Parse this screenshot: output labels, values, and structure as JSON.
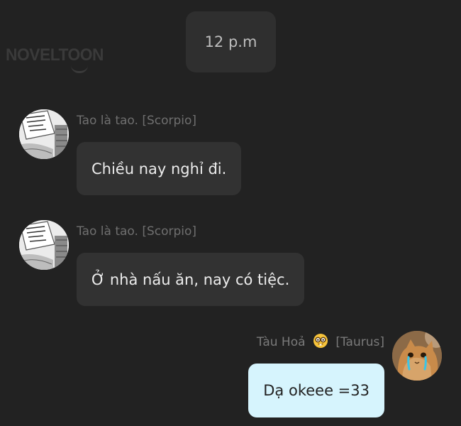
{
  "watermark": {
    "text": "NOVELTOON"
  },
  "timestamp": "12 p.m",
  "messages": [
    {
      "sender": "Tao là tao. [Scorpio]",
      "text": "Chiều nay nghỉ đi.",
      "avatar": "manga-panel-avatar"
    },
    {
      "sender": "Tao là tao. [Scorpio]",
      "text": "Ở nhà nấu ăn, nay có tiệc.",
      "avatar": "manga-panel-avatar"
    },
    {
      "sender_name": "Tàu Hoả",
      "sender_tag": "[Taurus]",
      "text": "Dạ okeee =33",
      "avatar": "crying-cat-avatar",
      "emoji": "nerd-face-icon"
    }
  ],
  "colors": {
    "background": "#222222",
    "bubble_other": "#323232",
    "bubble_mine": "#d6f4fd",
    "sender_text": "#6f6f6f"
  }
}
